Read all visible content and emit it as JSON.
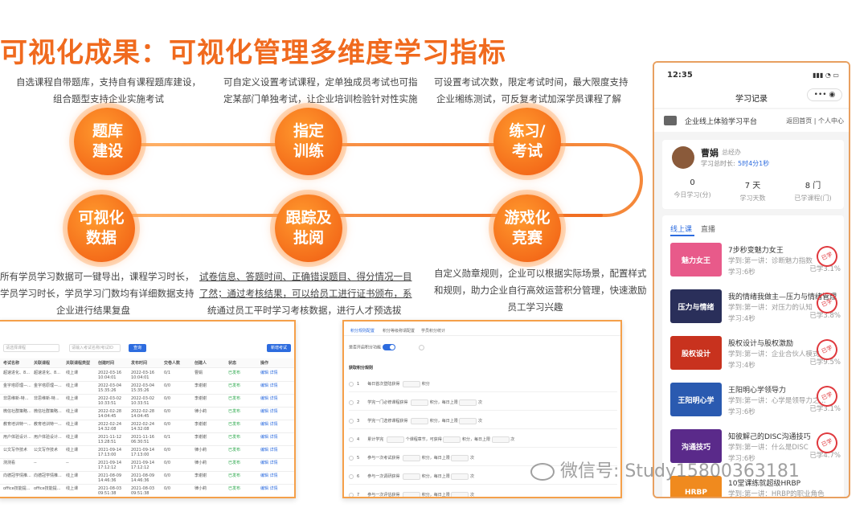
{
  "title": "可视化成果：可视化管理多维度学习指标",
  "descriptions": {
    "tiku": [
      "自选课程自带题库，支持自有课程题库建设，",
      "组合题型支持企业实施考试"
    ],
    "zhiding": [
      "可自定义设置考试课程，定单独成员考试也可指",
      "定某部门单独考试，让企业培训检验针对性实施"
    ],
    "lianxi": [
      "可设置考试次数，限定考试时间，最大限度支持",
      "企业缃练测试，可反复考试加深学员课程了解"
    ],
    "keshihua": [
      "所有学员学习数据可一键导出，课程学习时长，",
      "学员学习时长，学员学习门数均有详细数据支持",
      "企业进行结果复盘"
    ],
    "genzong": [
      "试卷信息、答题时间、正确错误题目、得分情况一目",
      "了然；通过考核结果，可以给员工进行证书颁布，系",
      "统通过员工平时学习考核数据，进行人才预选拔"
    ],
    "youxi": [
      "自定义勋章规则，企业可以根据实际场景，配置样式",
      "和规则，助力企业自行高效运营积分管理，快速激励",
      "员工学习兴趣"
    ]
  },
  "nodes": {
    "tiku": "题库\n建设",
    "zhiding": "指定\n训练",
    "lianxi": "练习/\n考试",
    "keshihua": "可视化\n数据",
    "genzong": "跟踪及\n批阅",
    "youxi": "游戏化\n竞赛"
  },
  "exam_panel": {
    "select1": "请选择课程",
    "search_placeholder": "请输入考试名称/考试ID",
    "query_button": "查询",
    "add_button": "新增考试",
    "headers": [
      "考试名称",
      "关联课程",
      "关联课程类型",
      "创建时间",
      "发布时间",
      "交卷人数",
      "创建人",
      "状态",
      "操作"
    ],
    "rows": [
      [
        "超速进化、8...",
        "超速进化、8...",
        "线上课",
        "2022-03-16 10:04:01",
        "2022-03-16 10:04:01",
        "0/1",
        "曹娟",
        "已发布",
        "编辑 详情"
      ],
      [
        "金字塔原理—...",
        "金字塔原理—...",
        "线上课",
        "2022-03-04 15:35:26",
        "2022-03-04 15:35:26",
        "0/0",
        "李谢谢",
        "已发布",
        "编辑 详情"
      ],
      [
        "非思维新-特...",
        "非思维新-特...",
        "线上课",
        "2022-03-02 10:33:51",
        "2022-03-02 10:33:51",
        "0/0",
        "李谢谢",
        "已发布",
        "编辑 详情"
      ],
      [
        "微信社群策略...",
        "微信社群策略...",
        "线上课",
        "2022-02-28 14:04:45",
        "2022-02-28 14:04:45",
        "0/0",
        "律小莉",
        "已发布",
        "编辑 详情"
      ],
      [
        "教育培训特一...",
        "教育培训特一...",
        "线上课",
        "2022-02-24 14:32:08",
        "2022-02-24 14:32:08",
        "0/0",
        "李谢谢",
        "已发布",
        "编辑 详情"
      ],
      [
        "用户体验设计...",
        "用户体验设计...",
        "线上课",
        "2021-11-12 13:28:51",
        "2021-11-16 06:30:51",
        "0/1",
        "李谢谢",
        "已发布",
        "编辑 详情"
      ],
      [
        "公文写作技术",
        "公文写作技术",
        "线上课",
        "2021-09-14 17:13:00",
        "2021-09-14 17:13:00",
        "0/0",
        "律小莉",
        "已发布",
        "编辑 详情"
      ],
      [
        "测测看",
        "--",
        "--",
        "2021-09-14 17:12:12",
        "2021-09-14 17:12:12",
        "0/0",
        "律小莉",
        "已发布",
        "编辑 详情"
      ],
      [
        "向德冠学情推...",
        "向德冠学情推...",
        "线上课",
        "2021-08-09 14:46:36",
        "2021-08-09 14:46:36",
        "0/0",
        "李谢谢",
        "已发布",
        "编辑 详情"
      ],
      [
        "office技能提...",
        "office技能提...",
        "线上课",
        "2021-08-03 09:51:38",
        "2021-08-03 09:51:38",
        "0/0",
        "律小莉",
        "已发布",
        "编辑 详情"
      ]
    ]
  },
  "points_panel": {
    "tabs": [
      "积分规则配置",
      "积分等级称谓配置",
      "学员积分统计"
    ],
    "enable_label": "是否开启积分功能",
    "section_title": "获取积分规则",
    "rules": [
      {
        "no": "1",
        "text": "每日首次登陆获得",
        "suffix": "积分"
      },
      {
        "no": "2",
        "text": "学完一门必修课程获得",
        "suffix": "积分，每日上限",
        "tail": "次"
      },
      {
        "no": "3",
        "text": "学完一门选修课程获得",
        "suffix": "积分，每日上限",
        "tail": "次"
      },
      {
        "no": "4",
        "text": "累计学完",
        "mid": "个课程章节，可获得",
        "suffix": "积分，每日上限",
        "tail": "次"
      },
      {
        "no": "5",
        "text": "参与一次考试获得",
        "suffix": "积分，每日上限",
        "tail": "次"
      },
      {
        "no": "6",
        "text": "参与一次调研获得",
        "suffix": "积分，每日上限",
        "tail": "次"
      },
      {
        "no": "7",
        "text": "参与一次评估获得",
        "suffix": "积分，每日上限",
        "tail": "次"
      }
    ]
  },
  "phone": {
    "time": "12:35",
    "nav_title": "学习记录",
    "platform": "企业线上体验学习平台",
    "links": "返回首页 | 个人中心",
    "user_name": "曹娟",
    "user_role": "总经办",
    "study_time_label": "学习总时长:",
    "study_time_value": "5时4分1秒",
    "stats": [
      {
        "value": "0",
        "label": "今日学习(分)"
      },
      {
        "value": "7 天",
        "label": "学习天数"
      },
      {
        "value": "8 门",
        "label": "已学课程(门)"
      }
    ],
    "tabs": [
      "线上课",
      "直播"
    ],
    "courses": [
      {
        "title": "7步秒变魅力女王",
        "sub": "学到:第一讲：诊断魅力指数",
        "dur": "学习:6秒",
        "prog": "已学3.1%",
        "thumb": "魅力女王",
        "color": "#e85a8a"
      },
      {
        "title": "我的情绪我做主—压力与情绪管理",
        "sub": "学到:第一讲：对压力的认知",
        "dur": "学习:4秒",
        "prog": "已学3.8%",
        "thumb": "压力与情绪",
        "color": "#2a2f5a"
      },
      {
        "title": "股权设计与股权激励",
        "sub": "学到:第一讲：企业合伙人模式",
        "dur": "学习:4秒",
        "prog": "已学9.5%",
        "thumb": "股权设计",
        "color": "#c8321e"
      },
      {
        "title": "王阳明心学领导力",
        "sub": "学到:第一讲：心学是领导力之...",
        "dur": "学习:6秒",
        "prog": "已学3.1%",
        "thumb": "王阳明心学",
        "color": "#2a5ab0"
      },
      {
        "title": "知彼解己的DISC沟通技巧",
        "sub": "学到:第一讲：什么是DISC",
        "dur": "学习:6秒",
        "prog": "已学4.7%",
        "thumb": "沟通技巧",
        "color": "#5a2a8a"
      },
      {
        "title": "10堂课练就超级HRBP",
        "sub": "学到:第一讲：HRBP的职业角色",
        "dur": "",
        "prog": "",
        "thumb": "HRBP",
        "color": "#f08a1e"
      }
    ],
    "stamp": "已学"
  },
  "watermark": "微信号: Study15800363181"
}
